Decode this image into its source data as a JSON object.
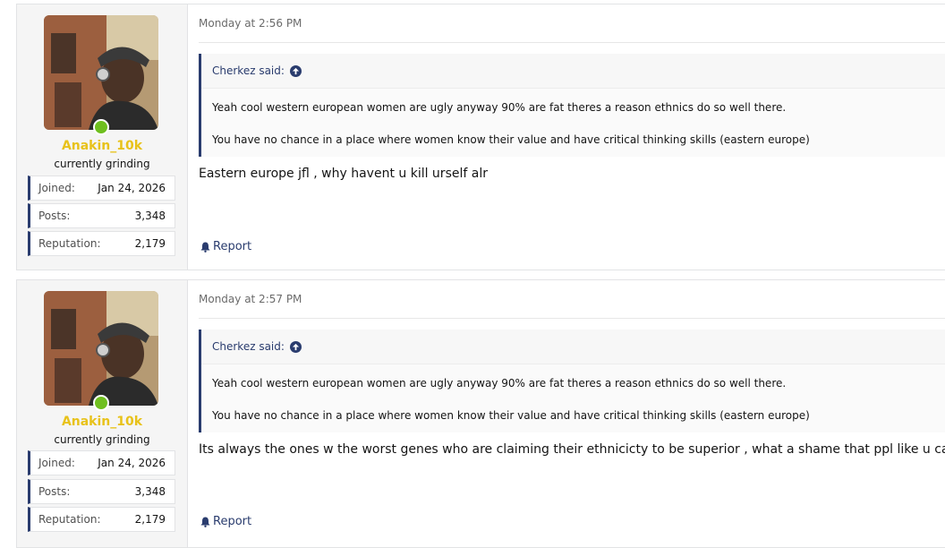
{
  "posts": [
    {
      "username": "Anakin_10k",
      "user_title": "currently grinding",
      "stats": [
        {
          "label": "Joined:",
          "value": "Jan 24, 2026"
        },
        {
          "label": "Posts:",
          "value": "3,348"
        },
        {
          "label": "Reputation:",
          "value": "2,179"
        }
      ],
      "date": "Monday at 2:56 PM",
      "quote": {
        "author": "Cherkez said:",
        "lines": [
          "Yeah cool western european women are ugly anyway 90% are fat theres a reason ethnics do so well there.",
          "You have no chance in a place where women know their value and have critical thinking skills (eastern europe)"
        ]
      },
      "message": "Eastern europe jfl , why havent u kill urself alr",
      "report_label": "Report"
    },
    {
      "username": "Anakin_10k",
      "user_title": "currently grinding",
      "stats": [
        {
          "label": "Joined:",
          "value": "Jan 24, 2026"
        },
        {
          "label": "Posts:",
          "value": "3,348"
        },
        {
          "label": "Reputation:",
          "value": "2,179"
        }
      ],
      "date": "Monday at 2:57 PM",
      "quote": {
        "author": "Cherkez said:",
        "lines": [
          "Yeah cool western european women are ugly anyway 90% are fat theres a reason ethnics do so well there.",
          "You have no chance in a place where women know their value and have critical thinking skills (eastern europe)"
        ]
      },
      "message": "Its always the ones w the worst genes who are claiming their ethnicicty to be superior , what a shame that ppl like u can live",
      "report_label": "Report"
    }
  ],
  "colors": {
    "accent": "#2a3c6e",
    "username": "#e8c21a",
    "online": "#6fbf1f"
  }
}
